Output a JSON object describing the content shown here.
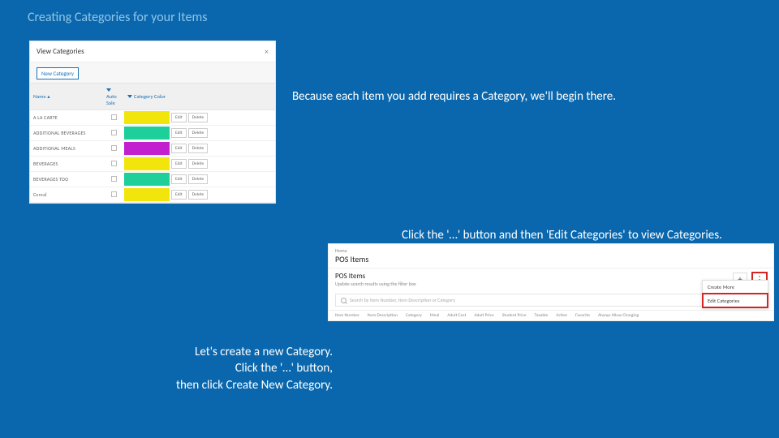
{
  "slide": {
    "title": "Creating Categories for your Items",
    "text1": "Because each item you add requires a Category, we'll begin there.",
    "text2": "Click the '…' button and then 'Edit Categories' to view Categories.",
    "text3a": "Let's  create a new Category.",
    "text3b": "Click the '…' button,",
    "text3c": "then click  Create New Category."
  },
  "cat": {
    "header": "View Categories",
    "close": "×",
    "new_btn": "New Category",
    "col_name": "Name ▴",
    "col_auto": "Auto Sale",
    "col_color": "Category Color",
    "edit": "Edit",
    "delete": "Delete",
    "rows": [
      {
        "name": "A LA CARTE",
        "color": "#f2e50b"
      },
      {
        "name": "ADDITIONAL BEVERAGES",
        "color": "#1fcf9a"
      },
      {
        "name": "ADDITIONAL MEALS",
        "color": "#c21fcf"
      },
      {
        "name": "BEVERAGES",
        "color": "#f2e50b"
      },
      {
        "name": "BEVERAGES TOO",
        "color": "#1fcf9a"
      },
      {
        "name": "Cereal",
        "color": "#f2e50b"
      }
    ]
  },
  "pos": {
    "crumb": "Home",
    "title": "POS Items",
    "ribbon_title": "POS Items",
    "ribbon_sub": "Update search results using the filter box",
    "plus": "+",
    "dots": "⋮",
    "menu_create": "Create More",
    "menu_edit": "Edit Categories",
    "search_ph": "Search by Item Number, Item Description or Category",
    "cols": [
      "Item Number",
      "Item Description",
      "Category",
      "Meal",
      "Adult Cost",
      "Adult Price",
      "Student Price",
      "Taxable",
      "Active",
      "Favorite",
      "Always Allow Charging"
    ]
  }
}
